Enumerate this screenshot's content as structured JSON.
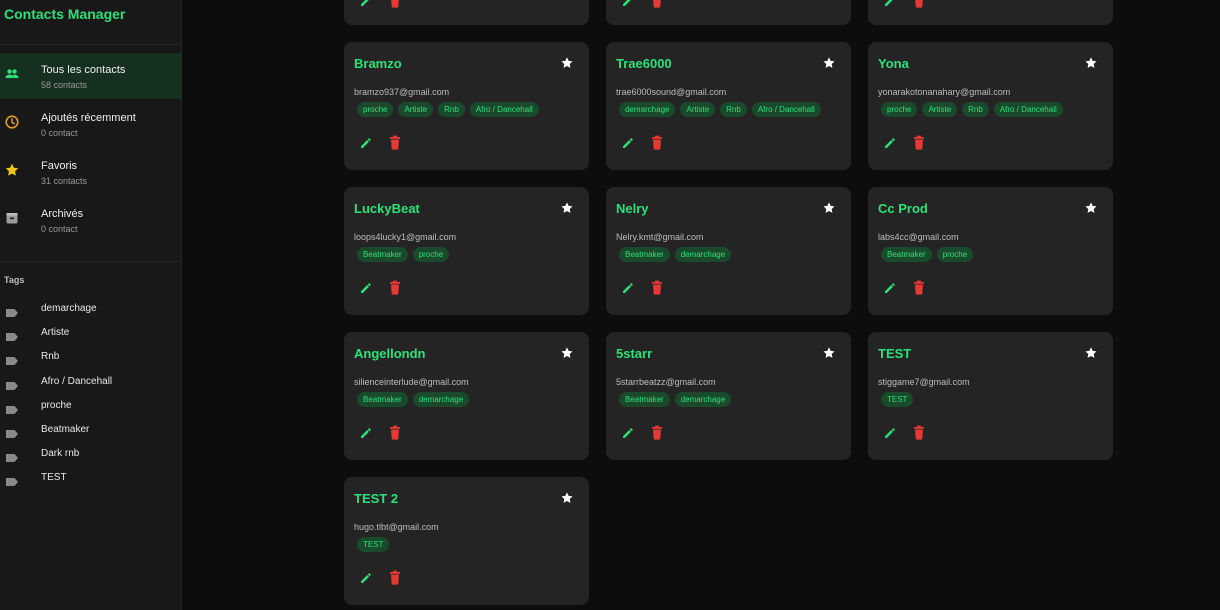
{
  "app": {
    "title": "Contacts Manager"
  },
  "nav": [
    {
      "label": "Tous les contacts",
      "count": "58 contacts",
      "icon": "people-icon",
      "active": true
    },
    {
      "label": "Ajoutés récemment",
      "count": "0 contact",
      "icon": "clock-icon",
      "active": false
    },
    {
      "label": "Favoris",
      "count": "31 contacts",
      "icon": "star-icon",
      "active": false
    },
    {
      "label": "Archivés",
      "count": "0 contact",
      "icon": "archive-icon",
      "active": false
    }
  ],
  "tags": {
    "heading": "Tags",
    "items": [
      "demarchage",
      "Artiste",
      "Rnb",
      "Afro / Dancehall",
      "proche",
      "Beatmaker",
      "Dark rnb",
      "TEST"
    ]
  },
  "contacts": [
    {
      "name": "Bramzo",
      "email": "bramzo937@gmail.com",
      "tags": [
        "proche",
        "Artiste",
        "Rnb",
        "Afro / Dancehall"
      ]
    },
    {
      "name": "Trae6000",
      "email": "trae6000sound@gmail.com",
      "tags": [
        "demarchage",
        "Artiste",
        "Rnb",
        "Afro / Dancehall"
      ]
    },
    {
      "name": "Yona",
      "email": "yonarakotonanahary@gmail.com",
      "tags": [
        "proche",
        "Artiste",
        "Rnb",
        "Afro / Dancehall"
      ]
    },
    {
      "name": "LuckyBeat",
      "email": "loops4lucky1@gmail.com",
      "tags": [
        "Beatmaker",
        "proche"
      ]
    },
    {
      "name": "Nelry",
      "email": "Nelry.kmt@gmail.com",
      "tags": [
        "Beatmaker",
        "demarchage"
      ]
    },
    {
      "name": "Cc Prod",
      "email": "labs4cc@gmail.com",
      "tags": [
        "Beatmaker",
        "proche"
      ]
    },
    {
      "name": "Angellondn",
      "email": "silienceinterlude@gmail.com",
      "tags": [
        "Beatmaker",
        "demarchage"
      ]
    },
    {
      "name": "5starr",
      "email": "5starrbeatzz@gmail.com",
      "tags": [
        "Beatmaker",
        "demarchage"
      ]
    },
    {
      "name": "TEST",
      "email": "stiggame7@gmail.com",
      "tags": [
        "TEST"
      ]
    },
    {
      "name": "TEST 2",
      "email": "hugo.tlbt@gmail.com",
      "tags": [
        "TEST"
      ]
    }
  ],
  "colors": {
    "accent": "#2ee079",
    "favoris_star": "#f5c518",
    "recent_clock": "#e09a2e",
    "delete": "#e53935",
    "card_bg": "#242424",
    "chip_bg": "#1a4a2c"
  }
}
